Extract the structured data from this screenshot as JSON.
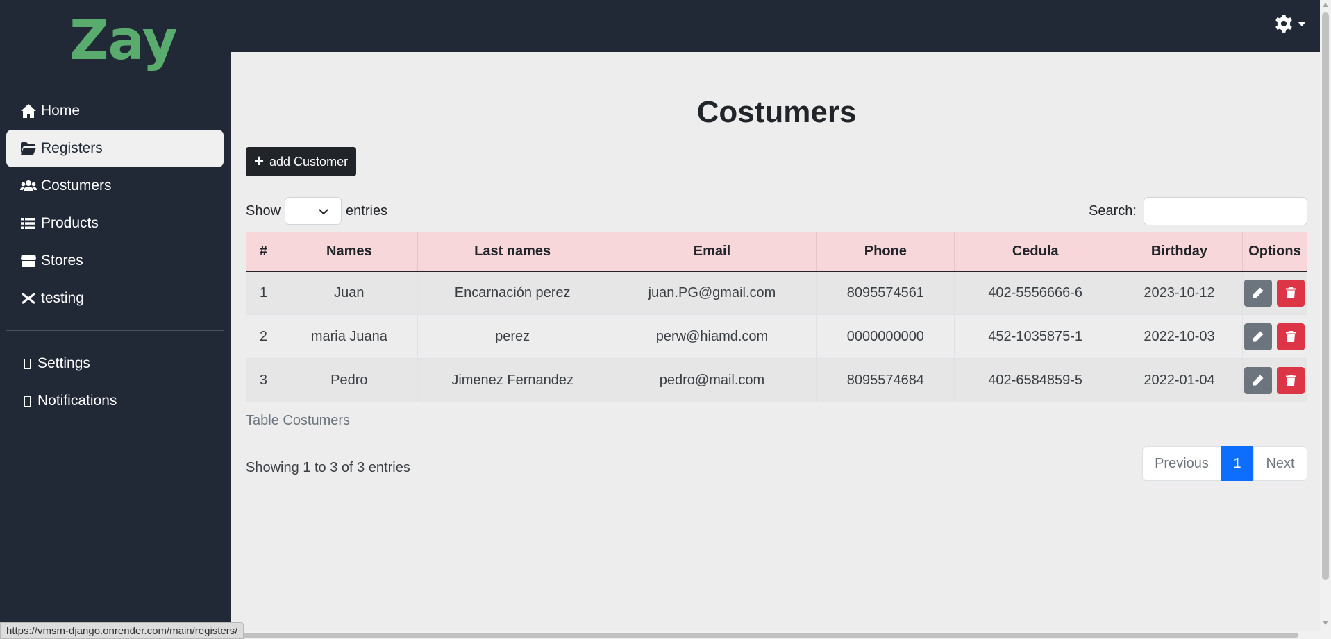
{
  "sidebar": {
    "logo": "Zay",
    "items": [
      {
        "label": "Home",
        "icon": "home-icon"
      },
      {
        "label": "Registers",
        "icon": "folder-open-icon",
        "active": true
      },
      {
        "label": "Costumers",
        "icon": "users-icon"
      },
      {
        "label": "Products",
        "icon": "list-icon"
      },
      {
        "label": "Stores",
        "icon": "store-icon"
      },
      {
        "label": "testing",
        "icon": "x-icon"
      }
    ],
    "secondary": [
      {
        "label": "Settings",
        "icon": "missing-glyph-icon"
      },
      {
        "label": "Notifications",
        "icon": "missing-glyph-icon"
      }
    ]
  },
  "topbar": {
    "settings_icon": "gear-icon"
  },
  "main": {
    "title": "Costumers",
    "add_label": "add Customer",
    "show_label": "Show",
    "entries_label": "entries",
    "search_label": "Search:",
    "search_value": "",
    "table": {
      "headers": [
        "#",
        "Names",
        "Last names",
        "Email",
        "Phone",
        "Cedula",
        "Birthday",
        "Options"
      ],
      "rows": [
        [
          "1",
          "Juan",
          "Encarnación perez",
          "juan.PG@gmail.com",
          "8095574561",
          "402-5556666-6",
          "2023-10-12"
        ],
        [
          "2",
          "maria Juana",
          "perez",
          "perw@hiamd.com",
          "0000000000",
          "452-1035875-1",
          "2022-10-03"
        ],
        [
          "3",
          "Pedro",
          "Jimenez Fernandez",
          "pedro@mail.com",
          "8095574684",
          "402-6584859-5",
          "2022-01-04"
        ]
      ],
      "caption": "Table Costumers"
    },
    "info": "Showing 1 to 3 of 3 entries",
    "pagination": {
      "previous": "Previous",
      "current": "1",
      "next": "Next"
    }
  },
  "status_url": "https://vmsm-django.onrender.com/main/registers/",
  "colors": {
    "sidebar_bg": "#212936",
    "logo": "#59ab6e",
    "header_row": "#f8d7da",
    "edit": "#6c757d",
    "delete": "#dc3545",
    "active_page": "#0d6efd"
  }
}
